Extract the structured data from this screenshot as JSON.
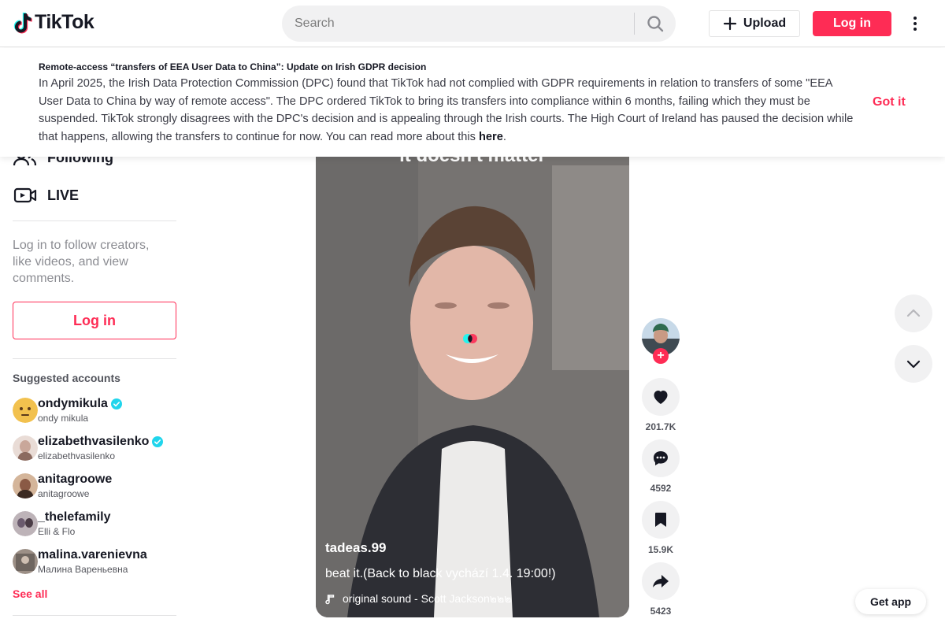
{
  "header": {
    "logo_text": "TikTok",
    "search_placeholder": "Search",
    "upload_label": "Upload",
    "login_label": "Log in"
  },
  "banner": {
    "title": "Remote-access “transfers of EEA User Data to China”: Update on Irish GDPR decision",
    "body": "In April 2025, the Irish Data Protection Commission (DPC) found that TikTok had not complied with GDPR requirements in relation to transfers of some \"EEA User Data to China by way of remote access\". The DPC ordered TikTok to bring its transfers into compliance within 6 months, failing which they must be suspended. TikTok strongly disagrees with the DPC's decision and is appealing through the Irish courts. The High Court of Ireland has paused the decision while that happens, allowing the transfers to continue for now. You can read more about this ",
    "link_text": "here",
    "trailing": ".",
    "dismiss_label": "Got it"
  },
  "sidebar": {
    "nav": [
      {
        "label": "Following",
        "icon": "following-icon"
      },
      {
        "label": "LIVE",
        "icon": "live-icon"
      }
    ],
    "login_prompt": "Log in to follow creators, like videos, and view comments.",
    "login_label": "Log in",
    "suggested_title": "Suggested accounts",
    "accounts": [
      {
        "username": "ondymikula",
        "nickname": "ondy mikula",
        "verified": true,
        "avatar_color": "#f2c14e"
      },
      {
        "username": "elizabethvasilenko",
        "nickname": "elizabethvasilenko",
        "verified": true,
        "avatar_color": "#c9a79a"
      },
      {
        "username": "anitagroowe",
        "nickname": "anitagroowe",
        "verified": false,
        "avatar_color": "#8a5a45"
      },
      {
        "username": "_thelefamily",
        "nickname": "Elli & Flo",
        "verified": false,
        "avatar_color": "#6b5b6e"
      },
      {
        "username": "malina.varenievna",
        "nickname": "Малина Вареньевна",
        "verified": false,
        "avatar_color": "#9c8f86"
      }
    ],
    "see_all_label": "See all"
  },
  "video": {
    "overlay_caption": "it doesn't matter",
    "author": "tadeas.99",
    "description": "beat it.(Back to black vychází 1.4. 19:00!)",
    "music": "original sound - Scott Jackson๒๒๒"
  },
  "actions": {
    "likes": "201.7K",
    "comments": "4592",
    "saves": "15.9K",
    "shares": "5423"
  },
  "get_app_label": "Get app",
  "colors": {
    "brand": "#fe2c55",
    "verified": "#20d5ec",
    "text": "#161823"
  }
}
